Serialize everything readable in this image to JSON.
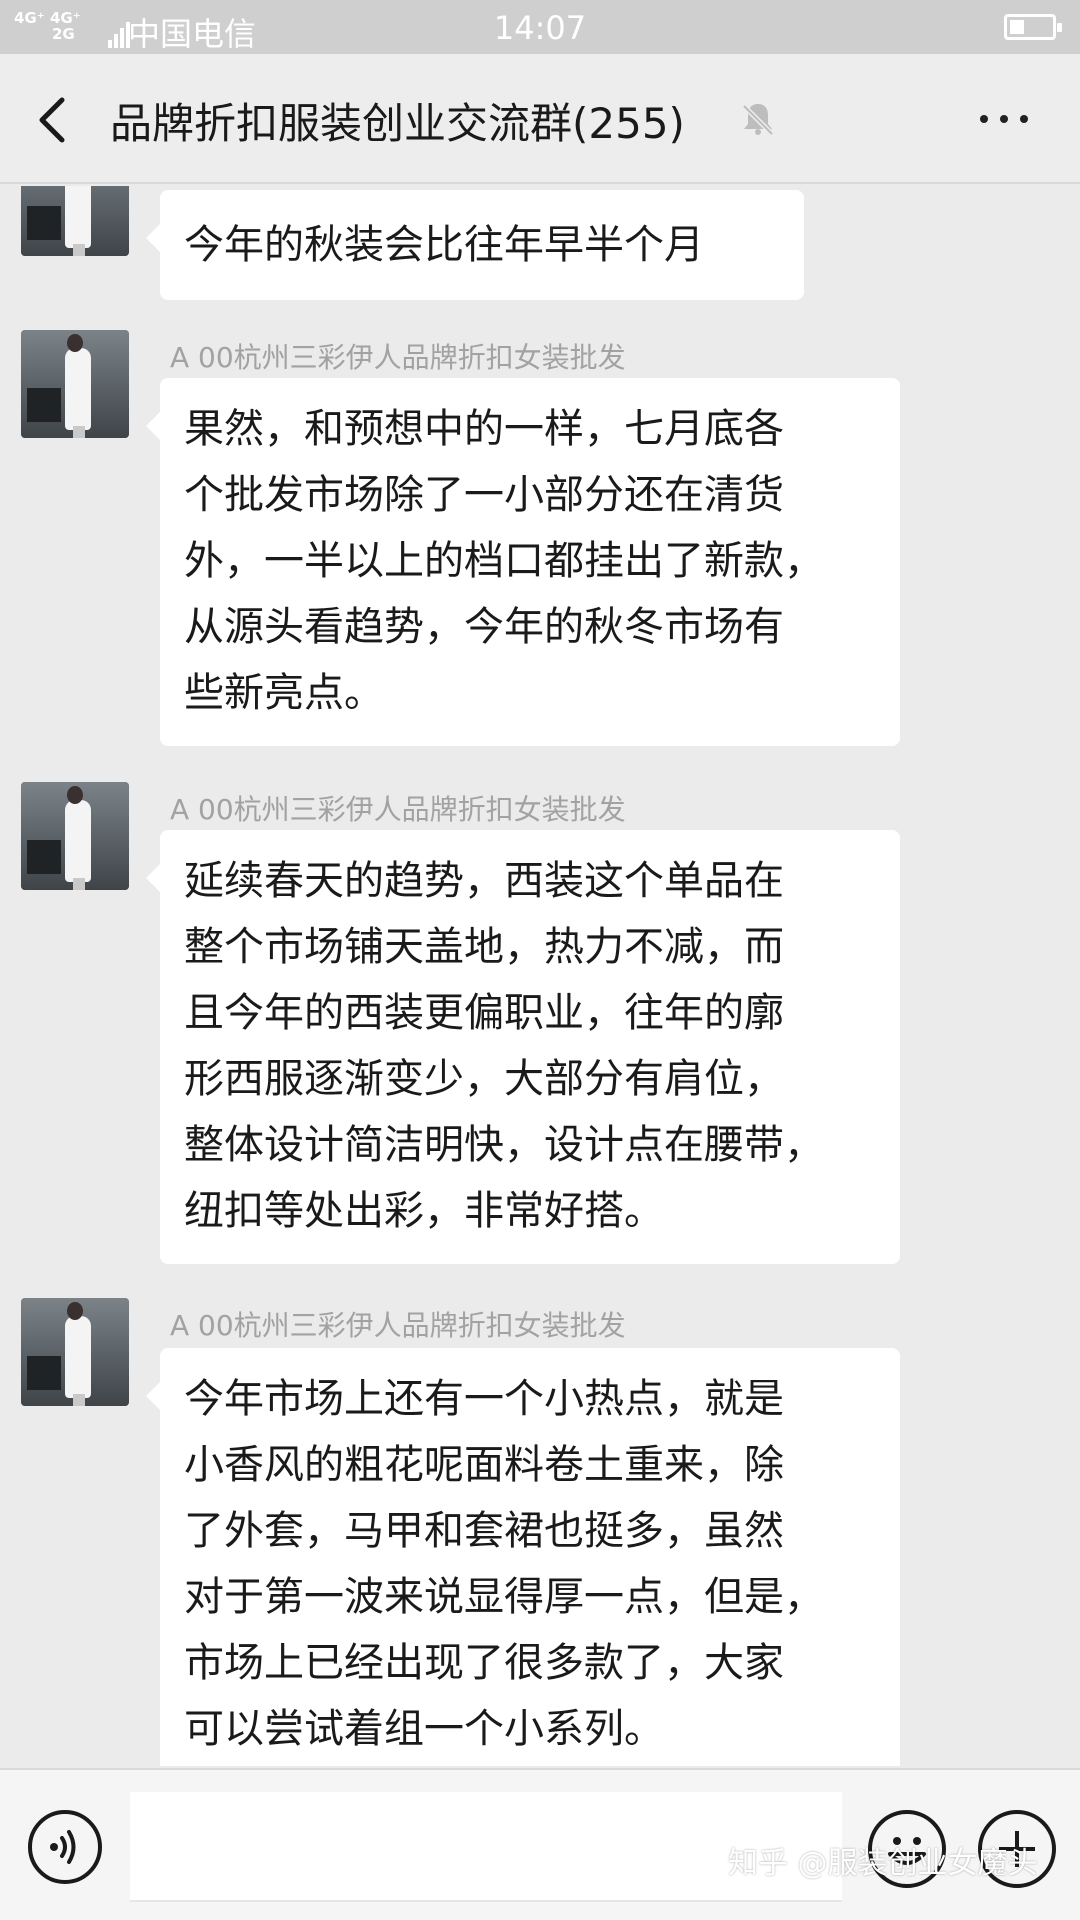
{
  "status_bar": {
    "network_1": "4G⁺",
    "network_2": "4G⁺",
    "network_3": "2G",
    "carrier": "中国电信",
    "time": "14:07",
    "battery_level": 0.35
  },
  "header": {
    "title": "品牌折扣服装创业交流群(255)",
    "back_icon": "back-chevron-icon",
    "mute_icon": "bell-muted-icon",
    "more_icon": "more-dots-icon"
  },
  "messages": [
    {
      "sender": "",
      "lines": [
        "今年的秋装会比往年早半个月"
      ]
    },
    {
      "sender": "A 00杭州三彩伊人品牌折扣女装批发",
      "lines": [
        "果然，和预想中的一样，七月底各",
        "个批发市场除了一小部分还在清货",
        "外，一半以上的档口都挂出了新款，",
        "从源头看趋势，今年的秋冬市场有",
        "些新亮点。"
      ]
    },
    {
      "sender": "A 00杭州三彩伊人品牌折扣女装批发",
      "lines": [
        "延续春天的趋势，西装这个单品在",
        "整个市场铺天盖地，热力不减，而",
        "且今年的西装更偏职业，往年的廓",
        "形西服逐渐变少，大部分有肩位，",
        "整体设计简洁明快，设计点在腰带，",
        "纽扣等处出彩，非常好搭。"
      ]
    },
    {
      "sender": "A 00杭州三彩伊人品牌折扣女装批发",
      "lines": [
        "今年市场上还有一个小热点，就是",
        "小香风的粗花呢面料卷土重来，除",
        "了外套，马甲和套裙也挺多，虽然",
        "对于第一波来说显得厚一点，但是，",
        "市场上已经出现了很多款了，大家",
        "可以尝试着组一个小系列。"
      ]
    }
  ],
  "input_bar": {
    "voice_icon": "voice-icon",
    "emoji_icon": "emoji-icon",
    "plus_icon": "plus-icon"
  },
  "watermark": "知乎 @服装创业女魔头",
  "colors": {
    "background": "#ebebeb",
    "bubble": "#ffffff",
    "status_bar": "#cfcfcf",
    "sender_text": "#a2a2a2"
  }
}
